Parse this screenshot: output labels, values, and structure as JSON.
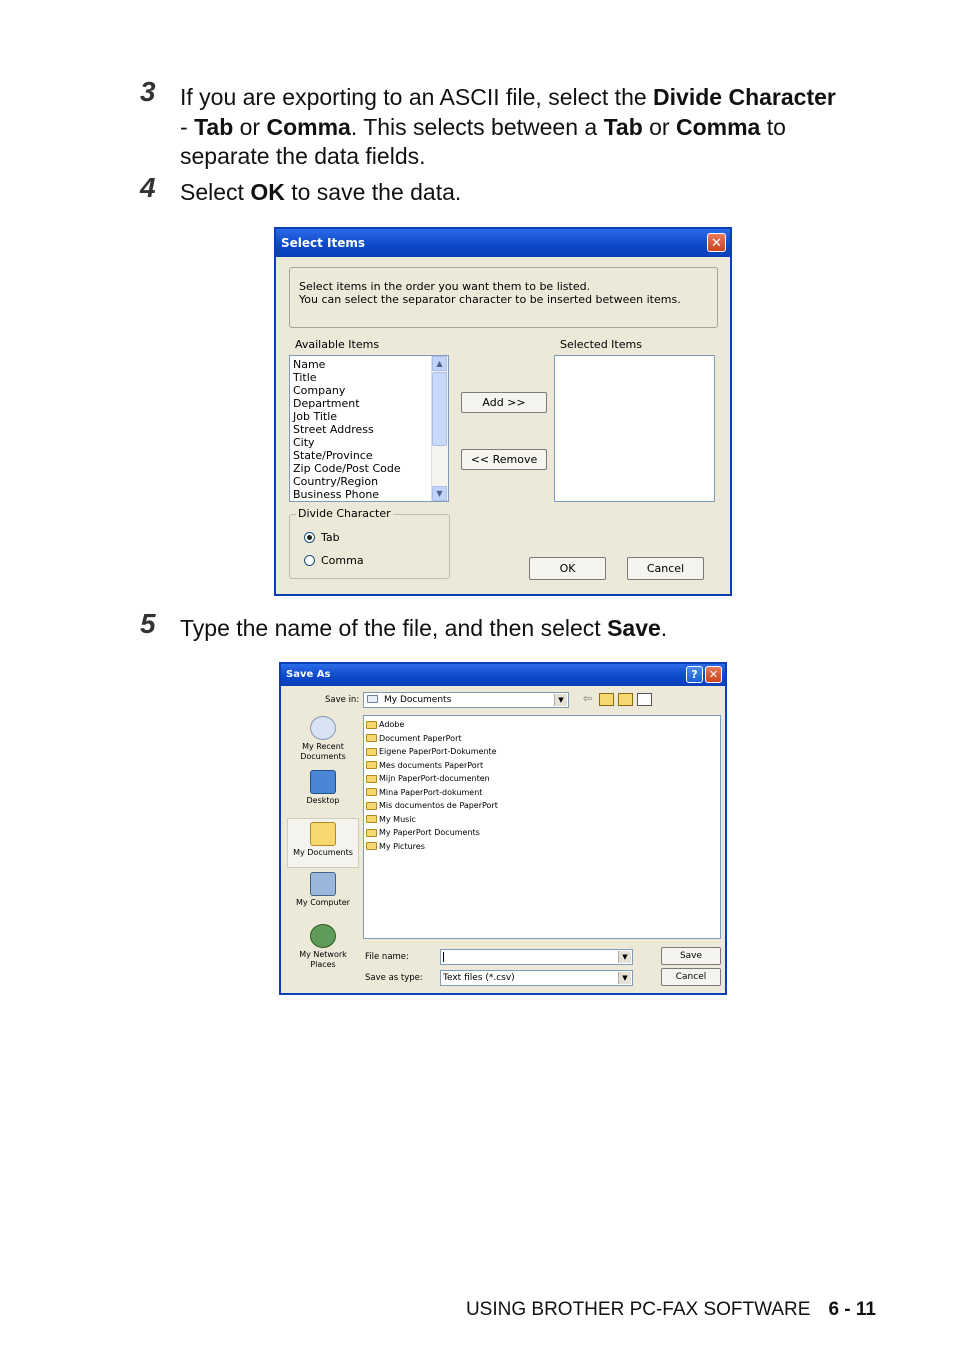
{
  "steps": [
    {
      "num": "3",
      "parts": [
        "If you are exporting to an ASCII file, select the ",
        "Divide Character",
        " - ",
        "Tab",
        " or ",
        "Comma",
        ". This selects between a ",
        "Tab",
        " or ",
        "Comma",
        " to separate the data fields."
      ]
    },
    {
      "num": "4",
      "parts": [
        "Select ",
        "OK",
        " to save the data."
      ]
    },
    {
      "num": "5",
      "parts": [
        "Type the name of the file, and then select ",
        "Save",
        "."
      ]
    }
  ],
  "select_items_dialog": {
    "title": "Select Items",
    "close": "✕",
    "instructions_1": "Select items in the order you want them to be listed.",
    "instructions_2": "You can select the separator character to be inserted between items.",
    "available_label": "Available Items",
    "selected_label": "Selected Items",
    "available_items": [
      "Name",
      "Title",
      "Company",
      "Department",
      "Job Title",
      "Street Address",
      "City",
      "State/Province",
      "Zip Code/Post Code",
      "Country/Region",
      "Business Phone"
    ],
    "add_button": "Add >>",
    "remove_button": "<< Remove",
    "divide_label": "Divide Character",
    "tab_option": "Tab",
    "comma_option": "Comma",
    "ok_button": "OK",
    "cancel_button": "Cancel",
    "selected_option": "tab"
  },
  "save_as_dialog": {
    "title": "Save As",
    "help": "?",
    "close": "✕",
    "save_in_label": "Save in:",
    "save_in_value": "My Documents",
    "places": [
      "My Recent Documents",
      "Desktop",
      "My Documents",
      "My Computer",
      "My Network Places"
    ],
    "files": [
      "Adobe",
      "Document PaperPort",
      "Eigene PaperPort-Dokumente",
      "Mes documents PaperPort",
      "Mijn PaperPort-documenten",
      "Mina PaperPort-dokument",
      "Mis documentos de PaperPort",
      "My Music",
      "My PaperPort Documents",
      "My Pictures"
    ],
    "file_name_label": "File name:",
    "file_name_value": "",
    "save_type_label": "Save as type:",
    "save_type_value": "Text files (*.csv)",
    "save_button": "Save",
    "cancel_button": "Cancel"
  },
  "footer": {
    "text": "USING BROTHER PC-FAX SOFTWARE",
    "page": "6 - 11"
  }
}
